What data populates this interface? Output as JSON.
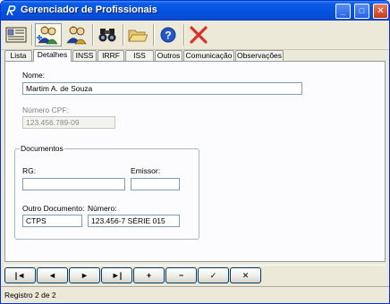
{
  "window": {
    "title": "Gerenciador de Profissionais"
  },
  "title_buttons": {
    "minimize": "_",
    "maximize": "□",
    "close": "✕"
  },
  "toolbar": {
    "tools": [
      {
        "icon": "id-card-list-icon"
      },
      {
        "icon": "add-user-icon"
      },
      {
        "icon": "edit-users-icon"
      },
      {
        "icon": "binoculars-icon"
      },
      {
        "icon": "open-folder-icon"
      },
      {
        "icon": "help-icon"
      },
      {
        "icon": "close-red-x-icon"
      }
    ]
  },
  "tabs": [
    {
      "label": "Lista"
    },
    {
      "label": "Detalhes",
      "active": true
    },
    {
      "label": "INSS"
    },
    {
      "label": "IRRF"
    },
    {
      "label": "ISS"
    },
    {
      "label": "Outros"
    },
    {
      "label": "Comunicação"
    },
    {
      "label": "Observações"
    }
  ],
  "form": {
    "nome_label": "Nome:",
    "nome_value": "Martim A. de Souza",
    "cpf_label": "Número CPF:",
    "cpf_value": "123.456.789-09",
    "documentos_title": "Documentos",
    "rg_label": "RG:",
    "rg_value": "",
    "emissor_label": "Emissor:",
    "emissor_value": "",
    "outro_doc_label": "Outro Documento:",
    "outro_doc_value": "CTPS",
    "numero_label": "Número:",
    "numero_value": "123.456-7 SÉRIE 015"
  },
  "navigator": {
    "first": "|◄",
    "prior": "◄",
    "next": "►",
    "last": "►|",
    "insert": "+",
    "delete": "−",
    "post": "✓",
    "cancel": "✕"
  },
  "status": {
    "text": "Registro 2 de 2"
  },
  "colors": {
    "titlebar": "#0553e0",
    "window_bg": "#ece9d8",
    "panel_bg": "#fcfcfe",
    "field_border": "#7f9db9",
    "close_red": "#d6332b"
  }
}
